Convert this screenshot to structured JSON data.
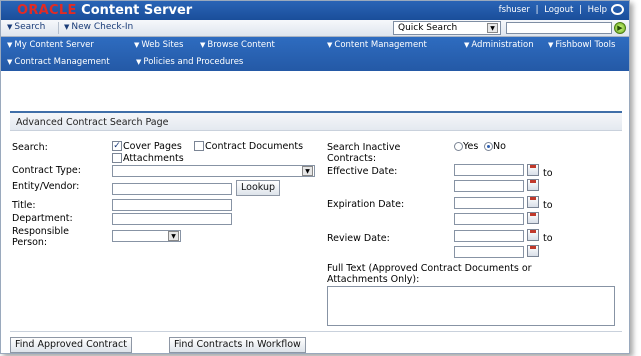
{
  "header": {
    "brand_oracle": "ORACLE",
    "brand_product": "Content Server",
    "user": "fshuser",
    "separator": "|",
    "logout": "Logout",
    "help": "Help"
  },
  "toolbar": {
    "search": "Search",
    "new_checkin": "New Check-In",
    "quick_search_label": "Quick Search",
    "quick_search_value": ""
  },
  "nav": {
    "items": [
      "My Content Server",
      "Web Sites",
      "Browse Content",
      "Content Management",
      "Administration",
      "Fishbowl Tools",
      "Contract Management",
      "Policies and Procedures"
    ]
  },
  "page": {
    "title": "Advanced Contract Search Page"
  },
  "form": {
    "search_label": "Search:",
    "cover_pages": "Cover Pages",
    "cover_pages_checked": true,
    "contract_documents": "Contract Documents",
    "contract_documents_checked": false,
    "attachments": "Attachments",
    "attachments_checked": false,
    "contract_type_label": "Contract Type:",
    "entity_vendor_label": "Entity/Vendor:",
    "lookup_button": "Lookup",
    "title_label": "Title:",
    "department_label": "Department:",
    "responsible_label_1": "Responsible",
    "responsible_label_2": "Person:",
    "search_inactive_label_1": "Search Inactive",
    "search_inactive_label_2": "Contracts:",
    "yes": "Yes",
    "no": "No",
    "inactive_selected": "No",
    "effective_date_label": "Effective Date:",
    "expiration_date_label": "Expiration Date:",
    "review_date_label": "Review Date:",
    "to": "to",
    "full_text_label_1": "Full Text (Approved Contract Documents or",
    "full_text_label_2": "Attachments Only):"
  },
  "buttons": {
    "find_approved": "Find Approved Contract",
    "find_workflow": "Find Contracts In Workflow"
  },
  "colors": {
    "header_blue": "#1f57a8",
    "nav_blue": "#2a63b3",
    "brand_red": "#e22b24"
  }
}
